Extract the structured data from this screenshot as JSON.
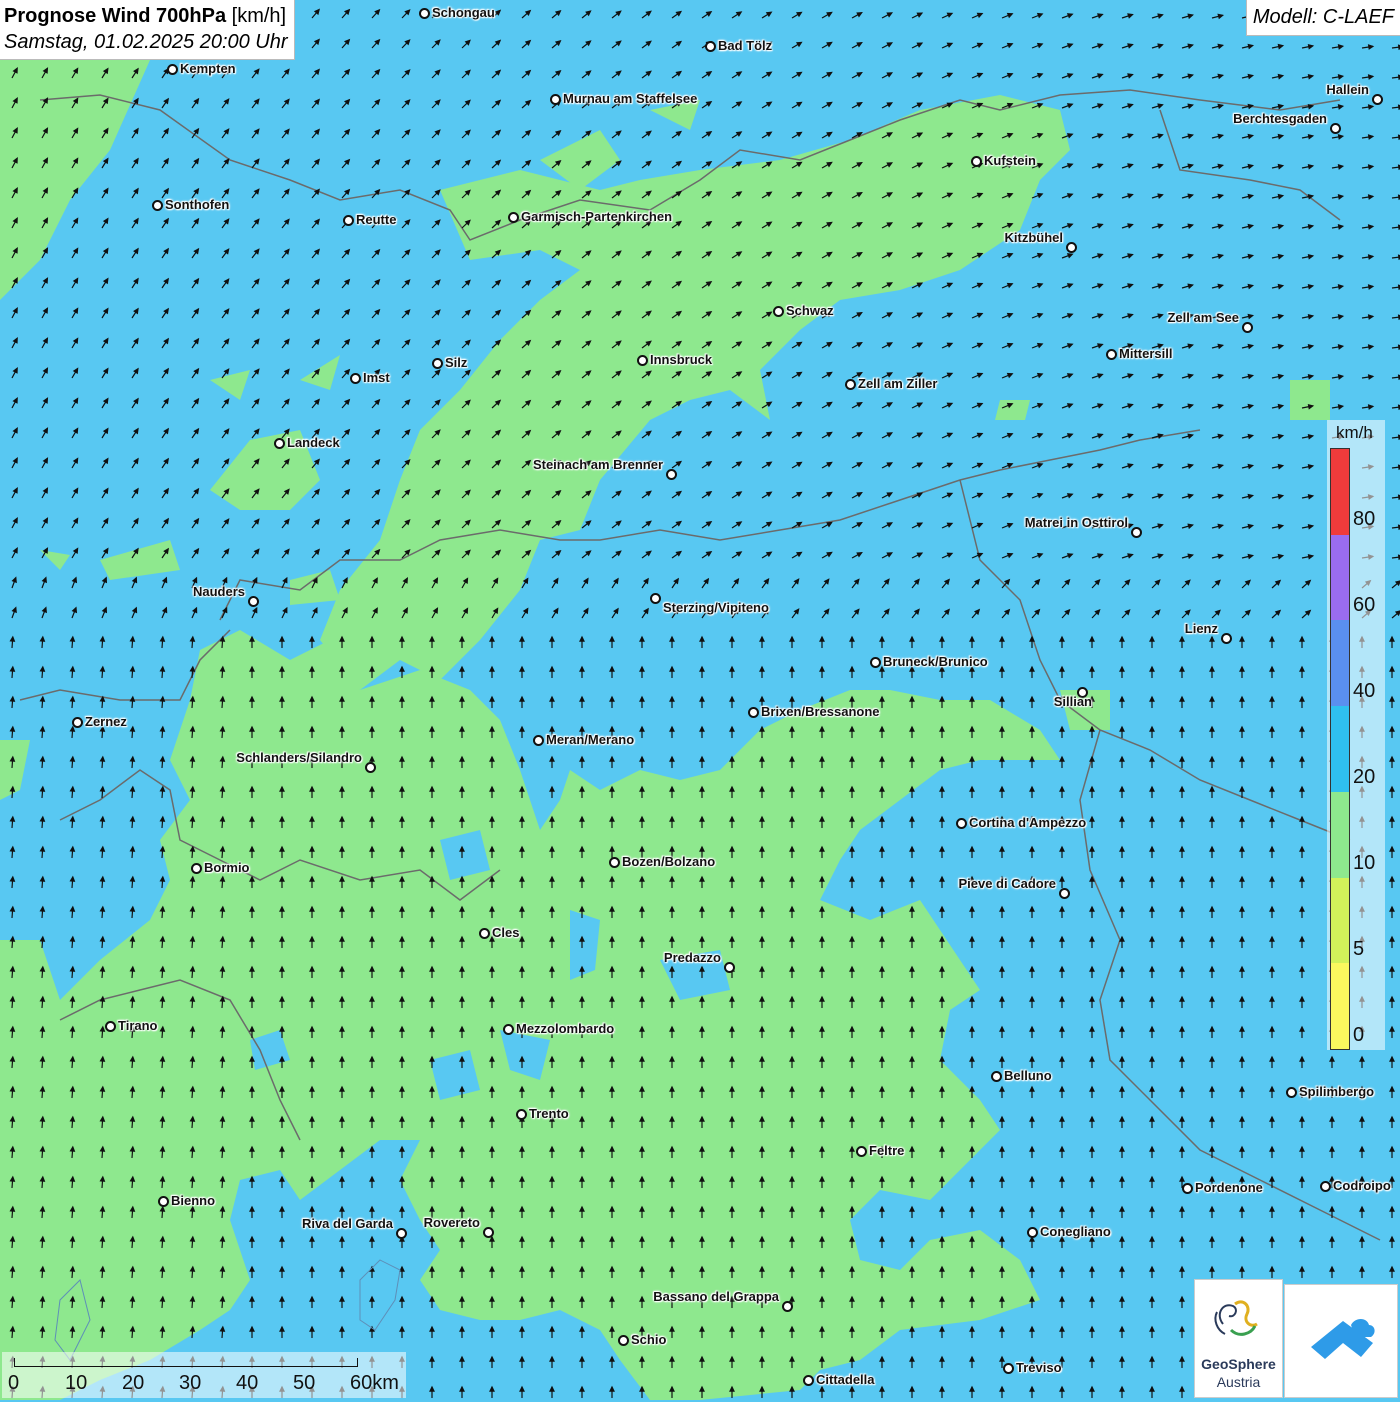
{
  "title": {
    "main_bold": "Prognose Wind 700hPa",
    "main_unit": " [km/h]",
    "subtitle": "Samstag, 01.02.2025 20:00 Uhr"
  },
  "model": "Modell: C-LAEF",
  "legend": {
    "unit": "km/h",
    "labels": [
      "80",
      "60",
      "40",
      "20",
      "10",
      "5",
      "0"
    ],
    "colors": [
      "#ef3b3b",
      "#9a6cf0",
      "#5a8ff0",
      "#2fc0f0",
      "#8ee88e",
      "#d2f25a",
      "#fbf85e"
    ]
  },
  "scale_bar": {
    "ticks": [
      "0",
      "10",
      "20",
      "30",
      "40",
      "50",
      "60km"
    ]
  },
  "logo": {
    "line1": "GeoSphere",
    "line2": "Austria"
  },
  "colors": {
    "wind_10_20": "#8ee88e",
    "wind_20_40": "#58c8f2",
    "border": "#6b6b6b"
  },
  "cities": [
    {
      "name": "Schongau"
    },
    {
      "name": "Bad Tölz"
    },
    {
      "name": "Kempten"
    },
    {
      "name": "Murnau am Staffelsee"
    },
    {
      "name": "Hallein"
    },
    {
      "name": "Berchtesgaden"
    },
    {
      "name": "Kufstein"
    },
    {
      "name": "Sonthofen"
    },
    {
      "name": "Reutte"
    },
    {
      "name": "Garmisch-Partenkirchen"
    },
    {
      "name": "Kitzbühel"
    },
    {
      "name": "Schwaz"
    },
    {
      "name": "Zell am See"
    },
    {
      "name": "Mittersill"
    },
    {
      "name": "Innsbruck"
    },
    {
      "name": "Silz"
    },
    {
      "name": "Imst"
    },
    {
      "name": "Zell am Ziller"
    },
    {
      "name": "Landeck"
    },
    {
      "name": "Steinach am Brenner"
    },
    {
      "name": "Matrei in Osttirol"
    },
    {
      "name": "Nauders"
    },
    {
      "name": "Sterzing/Vipiteno"
    },
    {
      "name": "Lienz"
    },
    {
      "name": "Bruneck/Brunico"
    },
    {
      "name": "Sillian"
    },
    {
      "name": "Brixen/Bressanone"
    },
    {
      "name": "Zernez"
    },
    {
      "name": "Meran/Merano"
    },
    {
      "name": "Schlanders/Silandro"
    },
    {
      "name": "Cortina d'Ampezzo"
    },
    {
      "name": "Bozen/Bolzano"
    },
    {
      "name": "Bormio"
    },
    {
      "name": "Pieve di Cadore"
    },
    {
      "name": "Cles"
    },
    {
      "name": "Predazzo"
    },
    {
      "name": "Tirano"
    },
    {
      "name": "Mezzolombardo"
    },
    {
      "name": "Belluno"
    },
    {
      "name": "Spilimbergo"
    },
    {
      "name": "Trento"
    },
    {
      "name": "Feltre"
    },
    {
      "name": "Pordenone"
    },
    {
      "name": "Codroipo"
    },
    {
      "name": "Bienno"
    },
    {
      "name": "Riva del Garda"
    },
    {
      "name": "Rovereto"
    },
    {
      "name": "Conegliano"
    },
    {
      "name": "Bassano del Grappa"
    },
    {
      "name": "Schio"
    },
    {
      "name": "Treviso"
    },
    {
      "name": "Cittadella"
    }
  ]
}
